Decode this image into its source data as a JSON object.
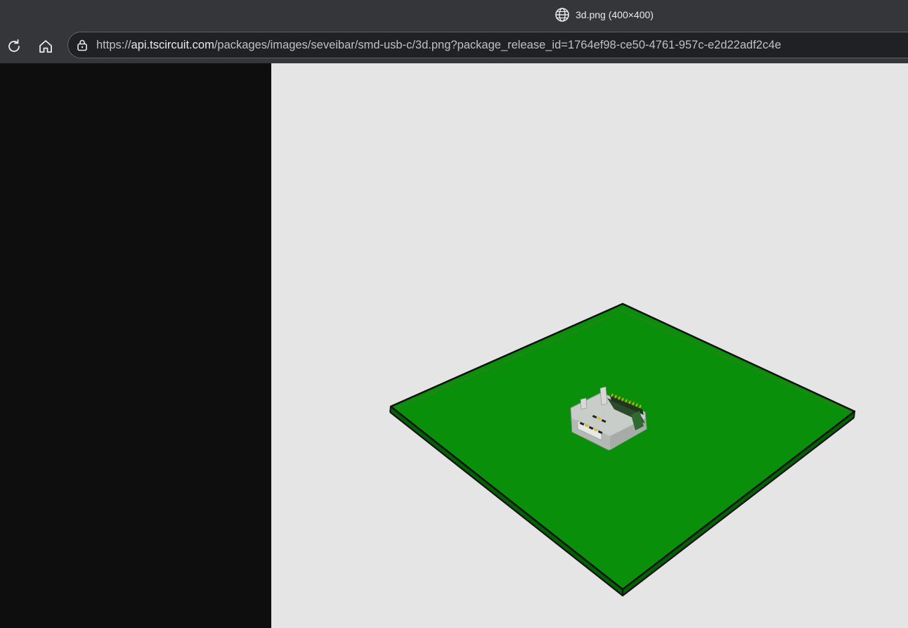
{
  "browser": {
    "tab_title": "3d.png (400×400)",
    "tab_icon": "globe-icon",
    "reload_icon": "reload-icon",
    "home_icon": "home-icon",
    "security_icon": "lock-icon",
    "url_scheme": "https://",
    "url_host": "api.tscircuit.com",
    "url_path": "/packages/images/seveibar/smd-usb-c/3d.png?package_release_id=1764ef98-ce50-4761-957c-e2d22adf2c4e"
  },
  "content": {
    "image_alt": "3D render of a green PCB with a USB-C connector",
    "colors": {
      "background": "#e5e5e5",
      "board_top": "#0a8f0a",
      "board_edge": "#046004",
      "outline": "#111111"
    }
  }
}
